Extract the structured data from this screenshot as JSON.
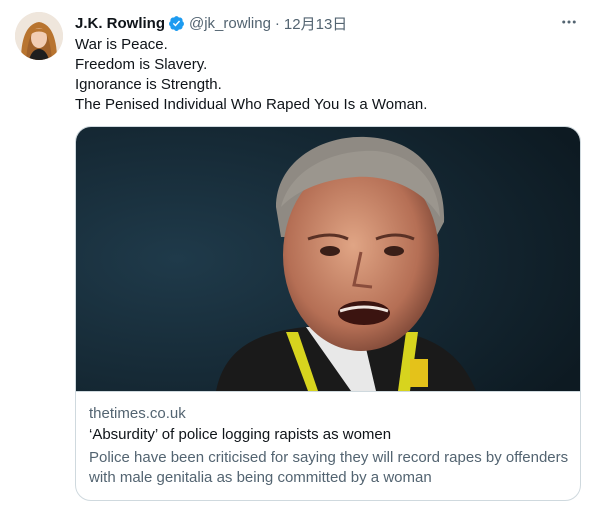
{
  "tweet": {
    "display_name": "J.K. Rowling",
    "verified_icon": "verified-badge-icon",
    "handle": "@jk_rowling",
    "separator": "·",
    "timestamp": "12月13日",
    "more_icon": "more-dots-icon",
    "text_lines": [
      "War is Peace.",
      "Freedom is Slavery.",
      "Ignorance is Strength.",
      "The Penised Individual Who Raped You Is a Woman."
    ]
  },
  "card": {
    "image_description_icon": "man-speaking-photo",
    "domain": "thetimes.co.uk",
    "title": "‘Absurdity’ of police logging rapists as women",
    "description": "Police have been criticised for saying they will record rapes by offenders with male genitalia as being committed by a woman"
  },
  "colors": {
    "primary_text": "#0f1419",
    "secondary_text": "#536471",
    "verified_blue": "#1d9bf0",
    "border": "#cfd9de"
  }
}
